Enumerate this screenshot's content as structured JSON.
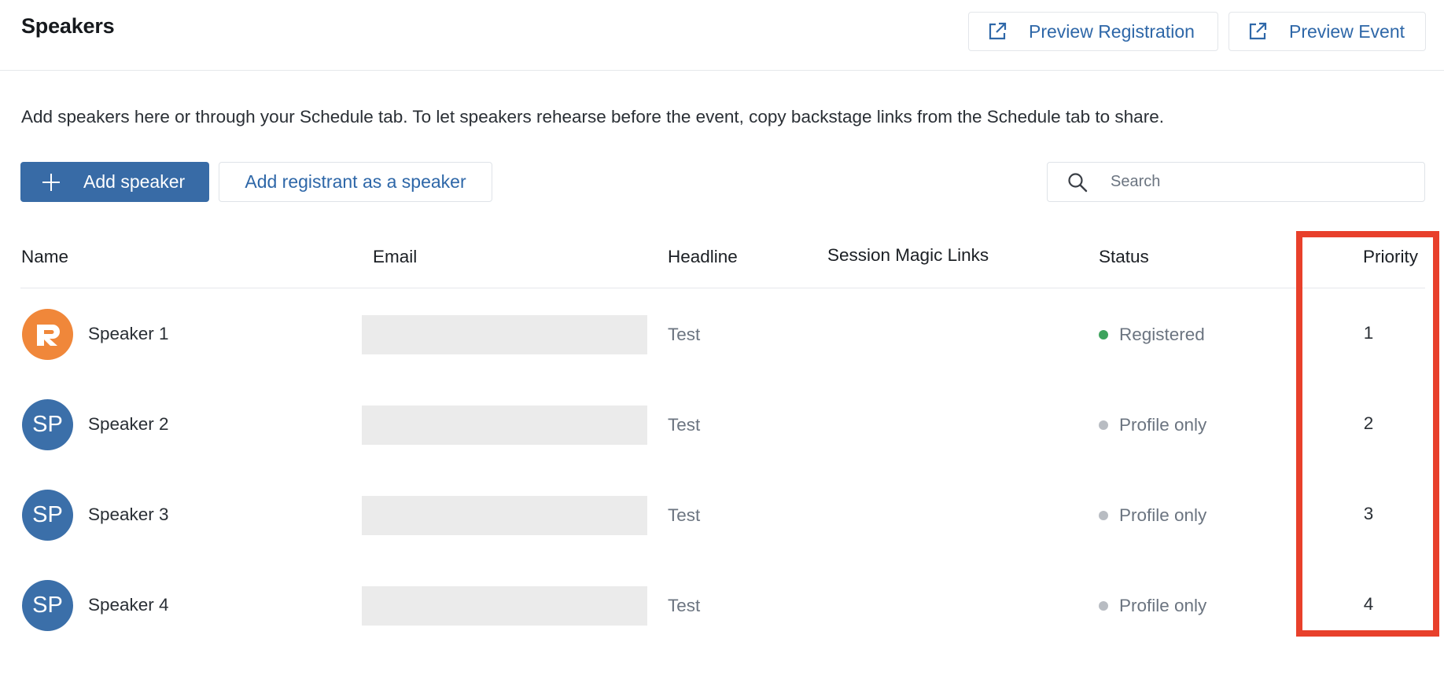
{
  "header": {
    "title": "Speakers",
    "preview_registration_label": "Preview Registration",
    "preview_event_label": "Preview Event"
  },
  "description": "Add speakers here or through your Schedule tab. To let speakers rehearse before the event, copy backstage links from the Schedule tab to share.",
  "actions": {
    "add_speaker_label": "Add speaker",
    "add_registrant_label": "Add registrant as a speaker",
    "search_placeholder": "Search",
    "search_value": ""
  },
  "table": {
    "columns": [
      "Name",
      "Email",
      "Headline",
      "Session Magic Links",
      "Status",
      "Priority"
    ],
    "rows": [
      {
        "avatar": "R",
        "avatar_type": "logo",
        "name": "Speaker 1",
        "email": "",
        "headline": "Test",
        "magic_links": "",
        "status": "Registered",
        "status_color": "#3da35d",
        "priority": "1"
      },
      {
        "avatar": "SP",
        "avatar_type": "initials",
        "name": "Speaker 2",
        "email": "",
        "headline": "Test",
        "magic_links": "",
        "status": "Profile only",
        "status_color": "#b8bcc2",
        "priority": "2"
      },
      {
        "avatar": "SP",
        "avatar_type": "initials",
        "name": "Speaker 3",
        "email": "",
        "headline": "Test",
        "magic_links": "",
        "status": "Profile only",
        "status_color": "#b8bcc2",
        "priority": "3"
      },
      {
        "avatar": "SP",
        "avatar_type": "initials",
        "name": "Speaker 4",
        "email": "",
        "headline": "Test",
        "magic_links": "",
        "status": "Profile only",
        "status_color": "#b8bcc2",
        "priority": "4"
      }
    ]
  },
  "colors": {
    "accent": "#386ba6",
    "link": "#2e67a8",
    "avatar_logo_bg": "#f0873a",
    "highlight": "#e8402b"
  },
  "icons": {
    "external_link": "external-link-icon",
    "search": "search-icon",
    "plus": "plus-icon"
  }
}
